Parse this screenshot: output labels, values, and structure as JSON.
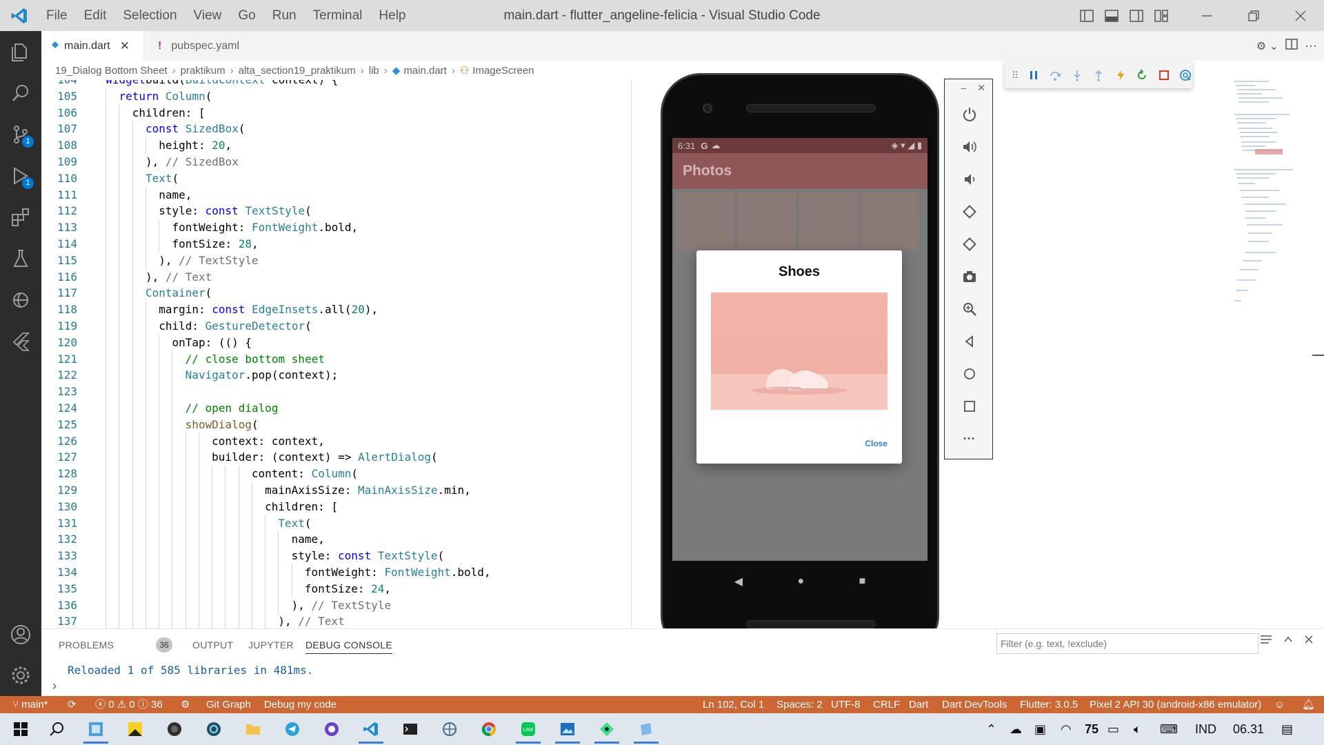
{
  "window": {
    "title": "main.dart - flutter_angeline-felicia - Visual Studio Code",
    "menu": [
      "File",
      "Edit",
      "Selection",
      "View",
      "Go",
      "Run",
      "Terminal",
      "Help"
    ]
  },
  "activity": {
    "source_control_badge": "1",
    "run_debug_badge": "1"
  },
  "tabs": [
    {
      "label": "main.dart",
      "active": true
    },
    {
      "label": "pubspec.yaml",
      "active": false
    }
  ],
  "breadcrumb": [
    "19_Dialog Bottom Sheet",
    "praktikum",
    "alta_section19_praktikum",
    "lib",
    "main.dart",
    "ImageScreen"
  ],
  "editor": {
    "lines": [
      {
        "n": "104",
        "indent": 1,
        "code": [
          [
            "k",
            "Widget"
          ],
          [
            "",
            "build("
          ],
          [
            "t",
            "BuildContext"
          ],
          [
            "",
            " context) {"
          ]
        ]
      },
      {
        "n": "105",
        "indent": 2,
        "code": [
          [
            "k",
            "return"
          ],
          [
            "",
            " "
          ],
          [
            "t",
            "Column"
          ],
          [
            "",
            "("
          ]
        ]
      },
      {
        "n": "106",
        "indent": 3,
        "code": [
          [
            "",
            "children: ["
          ]
        ]
      },
      {
        "n": "107",
        "indent": 4,
        "code": [
          [
            "k",
            "const"
          ],
          [
            "",
            " "
          ],
          [
            "t",
            "SizedBox"
          ],
          [
            "",
            "("
          ]
        ]
      },
      {
        "n": "108",
        "indent": 5,
        "code": [
          [
            "",
            "height: "
          ],
          [
            "n",
            "20"
          ],
          [
            "",
            ","
          ]
        ]
      },
      {
        "n": "109",
        "indent": 4,
        "code": [
          [
            "",
            "), "
          ],
          [
            "g",
            "// SizedBox"
          ]
        ]
      },
      {
        "n": "110",
        "indent": 4,
        "code": [
          [
            "t",
            "Text"
          ],
          [
            "",
            "("
          ]
        ]
      },
      {
        "n": "111",
        "indent": 5,
        "code": [
          [
            "",
            "name,"
          ]
        ]
      },
      {
        "n": "112",
        "indent": 5,
        "code": [
          [
            "",
            "style: "
          ],
          [
            "k",
            "const"
          ],
          [
            "",
            " "
          ],
          [
            "t",
            "TextStyle"
          ],
          [
            "",
            "("
          ]
        ]
      },
      {
        "n": "113",
        "indent": 6,
        "code": [
          [
            "",
            "fontWeight: "
          ],
          [
            "t",
            "FontWeight"
          ],
          [
            "",
            ".bold,"
          ]
        ]
      },
      {
        "n": "114",
        "indent": 6,
        "code": [
          [
            "",
            "fontSize: "
          ],
          [
            "n",
            "28"
          ],
          [
            "",
            ","
          ]
        ]
      },
      {
        "n": "115",
        "indent": 5,
        "code": [
          [
            "",
            "), "
          ],
          [
            "g",
            "// TextStyle"
          ]
        ]
      },
      {
        "n": "116",
        "indent": 4,
        "code": [
          [
            "",
            "), "
          ],
          [
            "g",
            "// Text"
          ]
        ]
      },
      {
        "n": "117",
        "indent": 4,
        "code": [
          [
            "t",
            "Container"
          ],
          [
            "",
            "("
          ]
        ]
      },
      {
        "n": "118",
        "indent": 5,
        "code": [
          [
            "",
            "margin: "
          ],
          [
            "k",
            "const"
          ],
          [
            "",
            " "
          ],
          [
            "t",
            "EdgeInsets"
          ],
          [
            "",
            ".all("
          ],
          [
            "n",
            "20"
          ],
          [
            "",
            "),"
          ]
        ]
      },
      {
        "n": "119",
        "indent": 5,
        "code": [
          [
            "",
            "child: "
          ],
          [
            "t",
            "GestureDetector"
          ],
          [
            "",
            "("
          ]
        ]
      },
      {
        "n": "120",
        "indent": 6,
        "code": [
          [
            "",
            "onTap: (() {"
          ]
        ]
      },
      {
        "n": "121",
        "indent": 7,
        "code": [
          [
            "c",
            "// close bottom sheet"
          ]
        ]
      },
      {
        "n": "122",
        "indent": 7,
        "code": [
          [
            "t",
            "Navigator"
          ],
          [
            "",
            ".pop(context);"
          ]
        ]
      },
      {
        "n": "123",
        "indent": 7,
        "code": []
      },
      {
        "n": "124",
        "indent": 7,
        "code": [
          [
            "c",
            "// open dialog"
          ]
        ]
      },
      {
        "n": "125",
        "indent": 7,
        "code": [
          [
            "p",
            "showDialog"
          ],
          [
            "",
            "("
          ]
        ]
      },
      {
        "n": "126",
        "indent": 9,
        "code": [
          [
            "",
            "context: context,"
          ]
        ]
      },
      {
        "n": "127",
        "indent": 9,
        "code": [
          [
            "",
            "builder: (context) => "
          ],
          [
            "t",
            "AlertDialog"
          ],
          [
            "",
            "("
          ]
        ]
      },
      {
        "n": "128",
        "indent": 12,
        "code": [
          [
            "",
            "content: "
          ],
          [
            "t",
            "Column"
          ],
          [
            "",
            "("
          ]
        ]
      },
      {
        "n": "129",
        "indent": 13,
        "code": [
          [
            "",
            "mainAxisSize: "
          ],
          [
            "t",
            "MainAxisSize"
          ],
          [
            "",
            ".min,"
          ]
        ]
      },
      {
        "n": "130",
        "indent": 13,
        "code": [
          [
            "",
            "children: ["
          ]
        ]
      },
      {
        "n": "131",
        "indent": 14,
        "code": [
          [
            "t",
            "Text"
          ],
          [
            "",
            "("
          ]
        ]
      },
      {
        "n": "132",
        "indent": 15,
        "code": [
          [
            "",
            "name,"
          ]
        ]
      },
      {
        "n": "133",
        "indent": 15,
        "code": [
          [
            "",
            "style: "
          ],
          [
            "k",
            "const"
          ],
          [
            "",
            " "
          ],
          [
            "t",
            "TextStyle"
          ],
          [
            "",
            "("
          ]
        ]
      },
      {
        "n": "134",
        "indent": 16,
        "code": [
          [
            "",
            "fontWeight: "
          ],
          [
            "t",
            "FontWeight"
          ],
          [
            "",
            ".bold,"
          ]
        ]
      },
      {
        "n": "135",
        "indent": 16,
        "code": [
          [
            "",
            "fontSize: "
          ],
          [
            "n",
            "24"
          ],
          [
            "",
            ","
          ]
        ]
      },
      {
        "n": "136",
        "indent": 15,
        "code": [
          [
            "",
            "), "
          ],
          [
            "g",
            "// TextStyle"
          ]
        ]
      },
      {
        "n": "137",
        "indent": 14,
        "code": [
          [
            "",
            "), "
          ],
          [
            "g",
            "// Text"
          ]
        ]
      }
    ]
  },
  "emulator": {
    "status_time": "6:31",
    "appbar_title": "Photos",
    "dialog_title": "Shoes",
    "dialog_action": "Close"
  },
  "panel": {
    "tabs": [
      "PROBLEMS",
      "OUTPUT",
      "JUPYTER",
      "DEBUG CONSOLE"
    ],
    "active_tab": "DEBUG CONSOLE",
    "problems_count": "36",
    "filter_placeholder": "Filter (e.g. text, !exclude)",
    "console_output": "Reloaded 1 of 585 libraries in 481ms.",
    "prompt": "›"
  },
  "statusbar": {
    "branch": "main*",
    "errors": "0",
    "warnings": "0",
    "infos": "36",
    "git_graph": "Git Graph",
    "debug_config": "Debug my code",
    "cursor": "Ln 102, Col 1",
    "spaces": "Spaces: 2",
    "encoding": "UTF-8",
    "eol": "CRLF",
    "language": "Dart",
    "devtools": "Dart DevTools",
    "flutter": "Flutter: 3.0.5",
    "device": "Pixel 2 API 30 (android-x86 emulator)"
  },
  "taskbar": {
    "temperature": "75",
    "language": "IND",
    "clock": "06.31"
  },
  "colors": {
    "accent": "#0078d4",
    "statusbar": "#cc6633",
    "activitybar": "#2c2c2c"
  }
}
